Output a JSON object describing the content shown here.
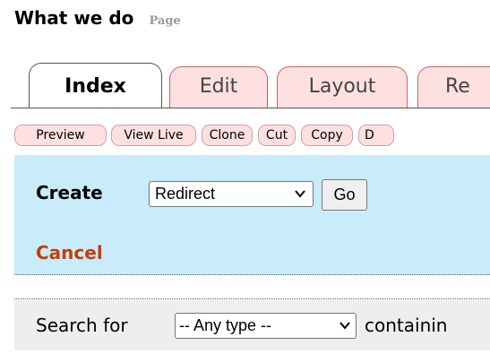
{
  "header": {
    "title": "What we do",
    "type_label": "Page"
  },
  "tabs": [
    {
      "label": "Index",
      "active": true
    },
    {
      "label": "Edit",
      "active": false
    },
    {
      "label": "Layout",
      "active": false
    },
    {
      "label": "Re",
      "active": false
    }
  ],
  "actions": [
    {
      "label": "Preview"
    },
    {
      "label": "View Live"
    },
    {
      "label": "Clone"
    },
    {
      "label": "Cut"
    },
    {
      "label": "Copy"
    },
    {
      "label": "D"
    }
  ],
  "create_panel": {
    "label": "Create",
    "selected_type": "Redirect",
    "go_label": "Go",
    "cancel_label": "Cancel"
  },
  "search": {
    "label": "Search for",
    "type_selected": "-- Any type --",
    "containing_label": "containin"
  },
  "colors": {
    "tab_inactive_bg": "#ffe0e0",
    "panel_bg": "#c8ecfa",
    "cancel_link": "#c83c0a",
    "search_bar_bg": "#eeeeee"
  }
}
